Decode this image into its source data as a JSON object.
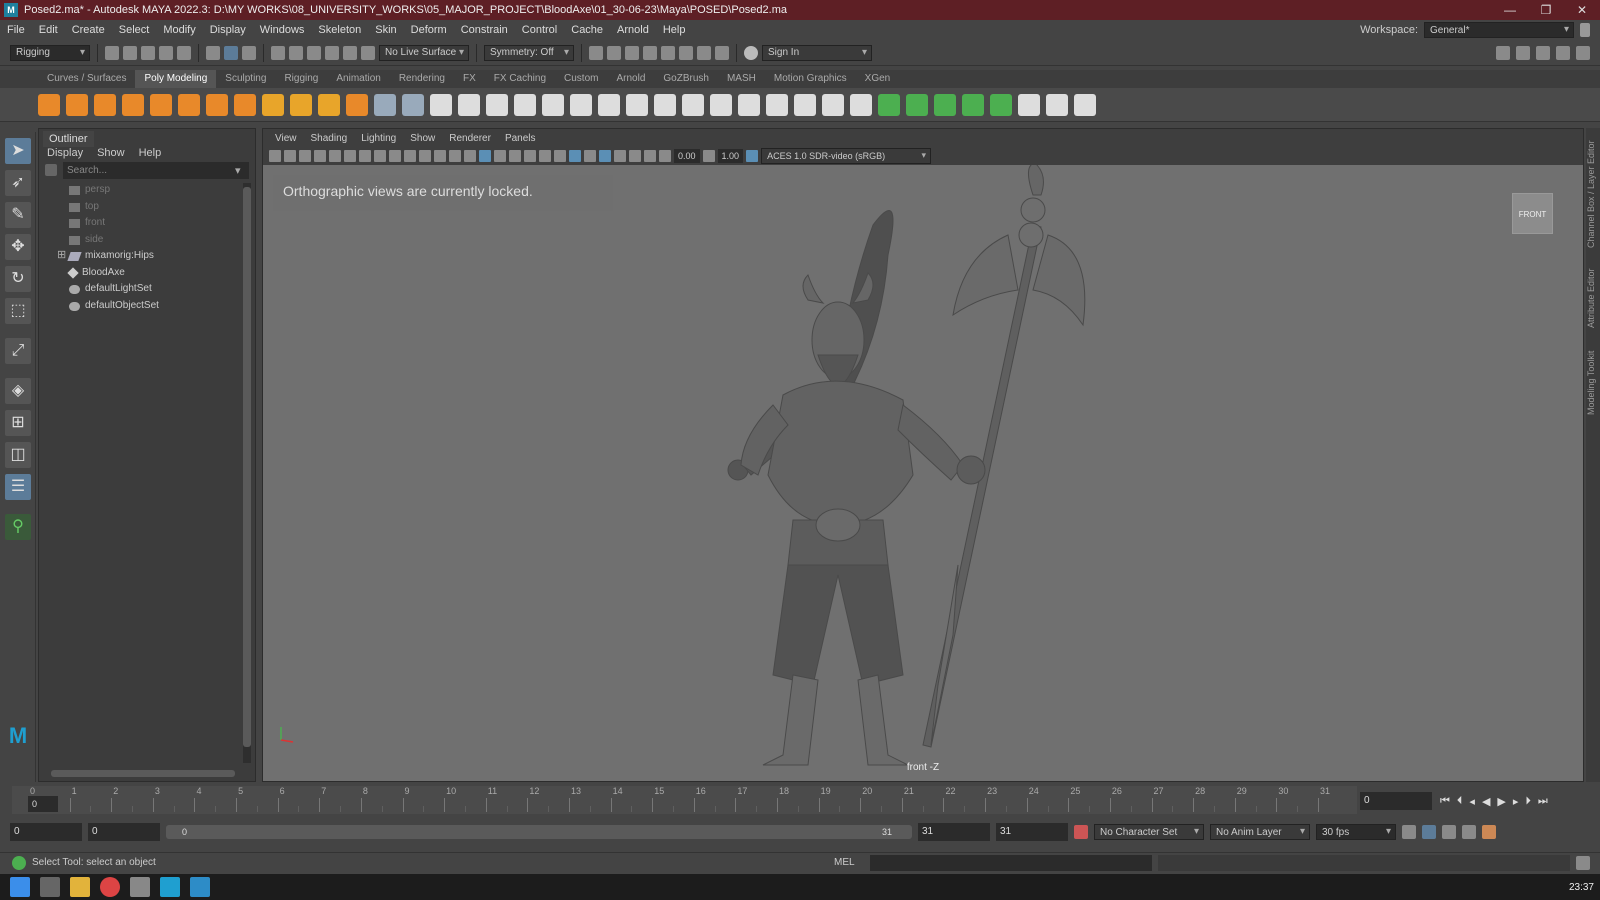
{
  "window": {
    "title": "Posed2.ma* - Autodesk MAYA 2022.3: D:\\MY WORKS\\08_UNIVERSITY_WORKS\\05_MAJOR_PROJECT\\BloodAxe\\01_30-06-23\\Maya\\POSED\\Posed2.ma",
    "minimize": "—",
    "maximize": "❐",
    "close": "✕"
  },
  "menubar": {
    "items": [
      "File",
      "Edit",
      "Create",
      "Select",
      "Modify",
      "Display",
      "Windows",
      "Skeleton",
      "Skin",
      "Deform",
      "Constrain",
      "Control",
      "Cache",
      "Arnold",
      "Help"
    ],
    "workspace_label": "Workspace:",
    "workspace_value": "General*"
  },
  "statusline": {
    "menuset": "Rigging",
    "live_surface": "No Live Surface",
    "symmetry": "Symmetry: Off",
    "sign_in": "Sign In"
  },
  "shelf": {
    "tabs": [
      "Curves / Surfaces",
      "Poly Modeling",
      "Sculpting",
      "Rigging",
      "Animation",
      "Rendering",
      "FX",
      "FX Caching",
      "Custom",
      "Arnold",
      "GoZBrush",
      "MASH",
      "Motion Graphics",
      "XGen"
    ],
    "active_tab": "Poly Modeling"
  },
  "outliner": {
    "title": "Outliner",
    "menu": [
      "Display",
      "Show",
      "Help"
    ],
    "search_placeholder": "Search...",
    "items": [
      {
        "label": "persp",
        "dim": true
      },
      {
        "label": "top",
        "dim": true
      },
      {
        "label": "front",
        "dim": true
      },
      {
        "label": "side",
        "dim": true
      },
      {
        "label": "mixamorig:Hips",
        "dim": false,
        "expand": "⊞"
      },
      {
        "label": "BloodAxe",
        "dim": false
      },
      {
        "label": "defaultLightSet",
        "dim": false
      },
      {
        "label": "defaultObjectSet",
        "dim": false
      }
    ]
  },
  "viewport": {
    "menu": [
      "View",
      "Shading",
      "Lighting",
      "Show",
      "Renderer",
      "Panels"
    ],
    "exposure": "0.00",
    "gamma": "1.00",
    "colorspace": "ACES 1.0 SDR-video (sRGB)",
    "locked_message": "Orthographic views are currently locked.",
    "view_cube": "FRONT",
    "camera_name": "front -Z"
  },
  "right_strip": [
    "Channel Box / Layer Editor",
    "Attribute Editor",
    "Modeling Toolkit"
  ],
  "timeline": {
    "ticks": [
      "0",
      "1",
      "2",
      "3",
      "4",
      "5",
      "6",
      "7",
      "8",
      "9",
      "10",
      "11",
      "12",
      "13",
      "14",
      "15",
      "16",
      "17",
      "18",
      "19",
      "20",
      "21",
      "22",
      "23",
      "24",
      "25",
      "26",
      "27",
      "28",
      "29",
      "30",
      "31"
    ],
    "current_frame": "0",
    "start_field": "0"
  },
  "range": {
    "start": "0",
    "anim_start": "0",
    "slider_start": "0",
    "slider_end": "31",
    "anim_end": "31",
    "end": "31",
    "character_set": "No Character Set",
    "anim_layer": "No Anim Layer",
    "fps": "30 fps"
  },
  "helpline": {
    "message": "Select Tool: select an object",
    "mel_label": "MEL"
  },
  "taskbar": {
    "clock": "23:37"
  },
  "colors": {
    "titlebar": "#5e1f25",
    "active_tool": "#5c7c99",
    "maya_logo": "#1f9fd0"
  }
}
